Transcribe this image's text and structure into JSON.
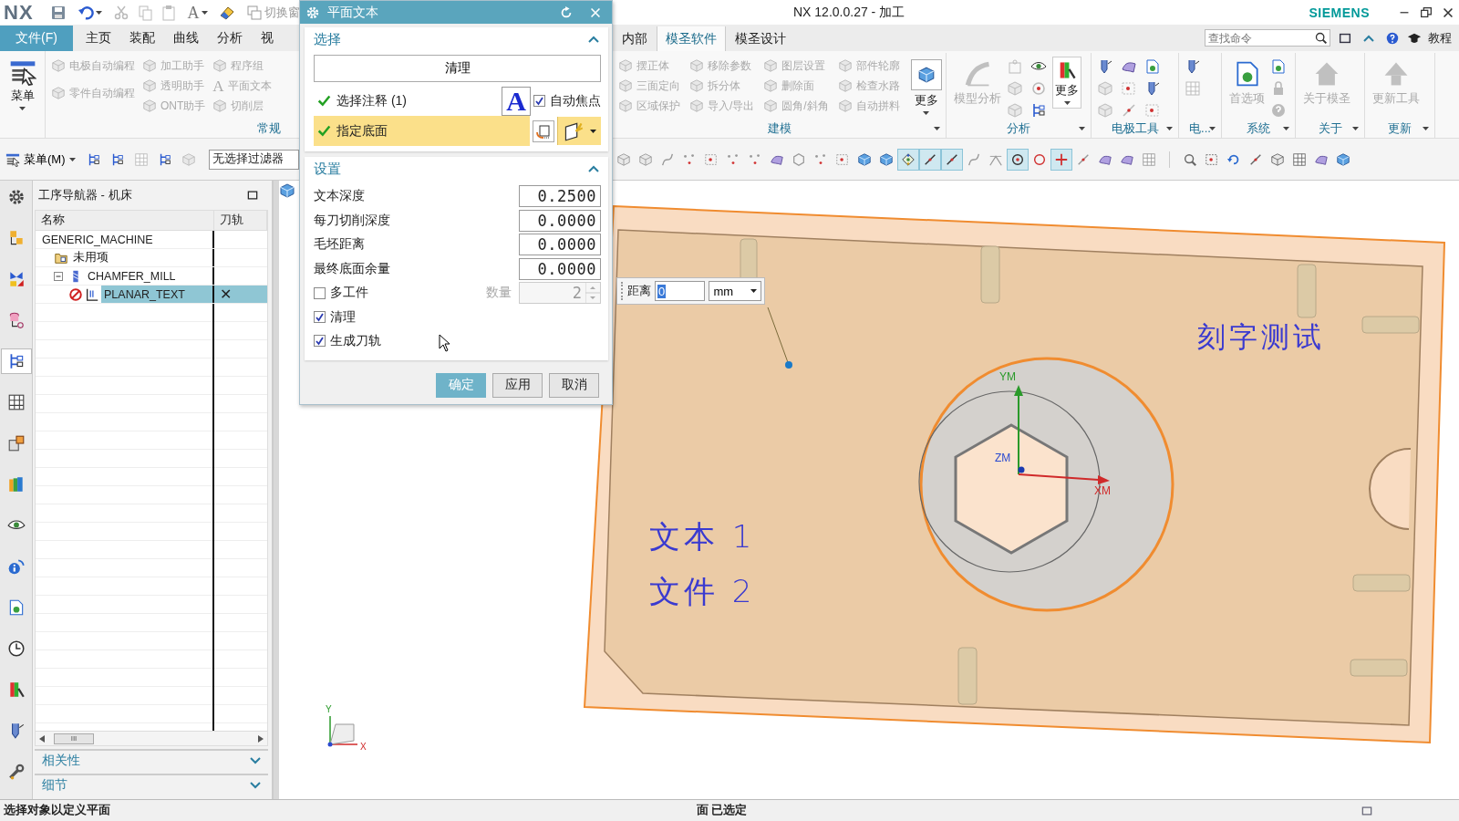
{
  "title_bar": {
    "logo": "NX",
    "text_glyph": "A",
    "switch_window": "切换窗",
    "title": "NX 12.0.0.27 - 加工",
    "brand": "SIEMENS"
  },
  "ribbon_tabs_left": [
    {
      "label": "文件(F)",
      "kind": "file",
      "selected": false
    },
    {
      "label": "主页",
      "kind": "tab",
      "selected": false
    },
    {
      "label": "装配",
      "kind": "tab",
      "selected": false
    },
    {
      "label": "曲线",
      "kind": "tab",
      "selected": false
    },
    {
      "label": "分析",
      "kind": "tab",
      "selected": false
    },
    {
      "label": "视",
      "kind": "tab",
      "selected": false
    }
  ],
  "ribbon_tabs_right": [
    {
      "label": "内部",
      "selected": false
    },
    {
      "label": "模圣软件",
      "selected": true
    },
    {
      "label": "模圣设计",
      "selected": false
    }
  ],
  "search": {
    "placeholder": "查找命令"
  },
  "help_label": "教程",
  "ribbon_left": {
    "menu_button": "菜单",
    "group_label": "常规",
    "columns": [
      [
        {
          "label": "电极自动编程",
          "disabled": true
        },
        {
          "label": "零件自动编程",
          "disabled": true
        }
      ],
      [
        {
          "label": "加工助手",
          "disabled": true
        },
        {
          "label": "透明助手",
          "disabled": true
        },
        {
          "label": "ONT助手",
          "disabled": true
        }
      ],
      [
        {
          "label": "程序组",
          "disabled": true
        },
        {
          "label": "平面文本",
          "disabled": true,
          "glyph": "A"
        },
        {
          "label": "切削层",
          "disabled": true
        }
      ]
    ]
  },
  "ribbon_right": [
    {
      "label": "建模",
      "kind": "modeling",
      "columns": [
        [
          {
            "label": "摆正体",
            "disabled": true
          },
          {
            "label": "三面定向",
            "disabled": true
          },
          {
            "label": "区域保护",
            "disabled": true
          }
        ],
        [
          {
            "label": "移除参数",
            "disabled": true
          },
          {
            "label": "拆分体",
            "disabled": true
          },
          {
            "label": "导入/导出",
            "disabled": true
          }
        ],
        [
          {
            "label": "图层设置",
            "disabled": true
          },
          {
            "label": "删除面",
            "disabled": true
          },
          {
            "label": "圆角/斜角",
            "disabled": true
          }
        ],
        [
          {
            "label": "部件轮廓",
            "disabled": true
          },
          {
            "label": "检查水路",
            "disabled": true
          },
          {
            "label": "自动拼料",
            "disabled": true
          }
        ]
      ],
      "buttons": [
        {
          "label": "更多",
          "kind": "more",
          "disabled": false
        }
      ]
    },
    {
      "label": "分析",
      "kind": "analysis",
      "buttons": [
        {
          "label": "模型分析",
          "kind": "large",
          "disabled": true
        },
        {
          "label": "更多",
          "kind": "more",
          "disabled": false
        }
      ]
    },
    {
      "label": "电极工具",
      "kind": "electrode"
    },
    {
      "label": "电...",
      "kind": "compact"
    },
    {
      "label": "系统",
      "kind": "system",
      "buttons": [
        {
          "label": "首选项",
          "kind": "large",
          "disabled": true
        }
      ]
    },
    {
      "label": "关于",
      "kind": "about",
      "buttons": [
        {
          "label": "关于模圣",
          "kind": "large",
          "disabled": true
        }
      ]
    },
    {
      "label": "更新",
      "kind": "update",
      "buttons": [
        {
          "label": "更新工具",
          "kind": "large",
          "disabled": true
        }
      ]
    }
  ],
  "toolbar": {
    "menu": "菜单(M)",
    "filter": "无选择过滤器",
    "snap_buttons": [
      {
        "kind": "cube",
        "on": false
      },
      {
        "kind": "cube",
        "on": false
      },
      {
        "kind": "curve",
        "on": false
      },
      {
        "kind": "point",
        "on": false
      },
      {
        "kind": "box",
        "on": false
      },
      {
        "kind": "point",
        "on": false
      },
      {
        "kind": "point",
        "on": false
      },
      {
        "kind": "surface",
        "on": false
      },
      {
        "kind": "hexagon",
        "on": false
      },
      {
        "kind": "point",
        "on": false
      },
      {
        "kind": "box",
        "on": false
      },
      {
        "kind": "block",
        "on": false
      },
      {
        "kind": "block",
        "on": false
      },
      {
        "kind": "snap",
        "on": true
      },
      {
        "kind": "line",
        "on": true
      },
      {
        "kind": "line",
        "on": true
      },
      {
        "kind": "curve",
        "on": false
      },
      {
        "kind": "tangent",
        "on": false
      },
      {
        "kind": "target",
        "on": true
      },
      {
        "kind": "circle",
        "on": false
      },
      {
        "kind": "cross",
        "on": true
      },
      {
        "kind": "line",
        "on": false
      },
      {
        "kind": "surface",
        "on": false
      },
      {
        "kind": "surface",
        "on": false
      },
      {
        "kind": "grid",
        "on": false
      }
    ],
    "view_buttons": [
      {
        "kind": "magnifier",
        "on": false
      },
      {
        "kind": "box",
        "on": false
      },
      {
        "kind": "rotate",
        "on": false
      },
      {
        "kind": "line",
        "on": false
      },
      {
        "kind": "cube",
        "on": false
      },
      {
        "kind": "grid",
        "on": false
      },
      {
        "kind": "surface",
        "on": false
      },
      {
        "kind": "block",
        "on": false
      }
    ]
  },
  "resource_bar": [
    {
      "kind": "gear",
      "selected": false
    },
    {
      "kind": "blocks",
      "selected": false
    },
    {
      "kind": "bowtie",
      "selected": false
    },
    {
      "kind": "cylinder",
      "selected": false
    },
    {
      "kind": "tree",
      "selected": true
    },
    {
      "kind": "grid",
      "selected": false
    },
    {
      "kind": "cubes",
      "selected": false
    },
    {
      "kind": "books",
      "selected": false
    },
    {
      "kind": "eye",
      "selected": false
    },
    {
      "kind": "info",
      "selected": false
    },
    {
      "kind": "document",
      "selected": false
    },
    {
      "kind": "clock",
      "selected": false
    },
    {
      "kind": "gradient",
      "selected": false
    },
    {
      "kind": "drill",
      "selected": false
    },
    {
      "kind": "wrench",
      "selected": false
    }
  ],
  "navigator": {
    "title": "工序导航器 - 机床",
    "columns": [
      "名称",
      "刀轨"
    ],
    "tree": [
      {
        "name": "GENERIC_MACHINE",
        "selected": false,
        "children": [
          {
            "name": "未用项",
            "kind": "folder",
            "selected": false
          },
          {
            "name": "CHAMFER_MILL",
            "kind": "tool",
            "selected": false,
            "expanded": true,
            "children": [
              {
                "name": "PLANAR_TEXT",
                "kind": "operation",
                "selected": true,
                "toolpath": "✕"
              }
            ]
          }
        ]
      }
    ],
    "scroll_glyph": "III",
    "sections": [
      {
        "label": "相关性",
        "expanded": false
      },
      {
        "label": "细节",
        "expanded": false
      }
    ]
  },
  "dialog": {
    "title": "平面文本",
    "select_section": {
      "label": "选择",
      "expanded": true,
      "clear_button": "清理",
      "annotation_glyph": "A",
      "rows": [
        {
          "label": "选择注释 (1)",
          "done": true,
          "highlighted": false
        },
        {
          "label": "指定底面",
          "done": true,
          "highlighted": true
        }
      ],
      "auto_focus": {
        "label": "自动焦点",
        "checked": true
      }
    },
    "settings_section": {
      "label": "设置",
      "expanded": true,
      "fields": [
        {
          "label": "文本深度",
          "value": "0.2500"
        },
        {
          "label": "每刀切削深度",
          "value": "0.0000"
        },
        {
          "label": "毛坯距离",
          "value": "0.0000"
        },
        {
          "label": "最终底面余量",
          "value": "0.0000"
        }
      ],
      "multi_part": {
        "label": "多工件",
        "checked": false
      },
      "count": {
        "label": "数量",
        "value": "2",
        "disabled": true
      },
      "options": [
        {
          "label": "清理",
          "checked": true
        },
        {
          "label": "生成刀轨",
          "checked": true
        }
      ]
    },
    "buttons": [
      {
        "label": "确定",
        "primary": true
      },
      {
        "label": "应用",
        "primary": false
      },
      {
        "label": "取消",
        "primary": false
      }
    ]
  },
  "distance_input": {
    "label": "距离",
    "value": "0",
    "unit": "mm"
  },
  "viewport": {
    "annotations": [
      "刻字测试",
      "文本 1",
      "文件 2"
    ],
    "axis_labels": [
      "YM",
      "ZM",
      "XM"
    ],
    "triad_labels": [
      "Y",
      "X"
    ]
  },
  "status_bar": {
    "prompt": "选择对象以定义平面",
    "selection": "面 已选定"
  }
}
